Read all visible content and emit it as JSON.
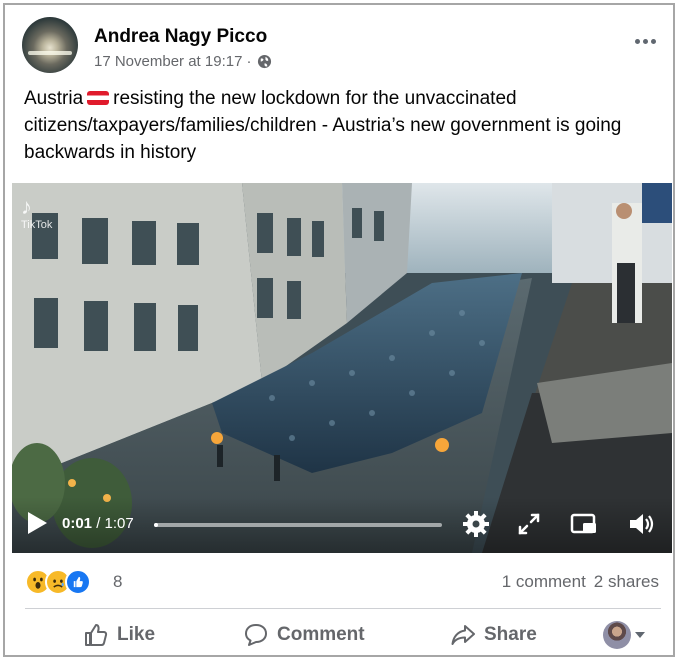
{
  "post": {
    "author": "Andrea Nagy Picco",
    "timestamp": "17 November at 19:17",
    "separator": "·",
    "privacy_icon": "globe-icon",
    "text_before_flag": "Austria",
    "flag": "austria-flag-emoji",
    "text_after_flag": "resisting the new lockdown for the unvaccinated citizens/taxpayers/families/children - Austria’s new government is going backwards in history"
  },
  "video": {
    "watermark": "TikTok",
    "current_time": "0:01",
    "duration": "/ 1:07",
    "progress": 0.015,
    "controls": [
      "play-icon",
      "settings-gear-icon",
      "fullscreen-icon",
      "miniplayer-icon",
      "volume-icon"
    ]
  },
  "stats": {
    "reactions": [
      "wow",
      "sad",
      "like"
    ],
    "reaction_count": "8",
    "comments": "1 comment",
    "shares": "2 shares"
  },
  "actions": {
    "like": "Like",
    "comment": "Comment",
    "share": "Share"
  },
  "colors": {
    "meta_text": "#65676b",
    "like_blue": "#1877f2",
    "reaction_yellow": "#f7b928",
    "flag_red": "#e01b2c"
  }
}
